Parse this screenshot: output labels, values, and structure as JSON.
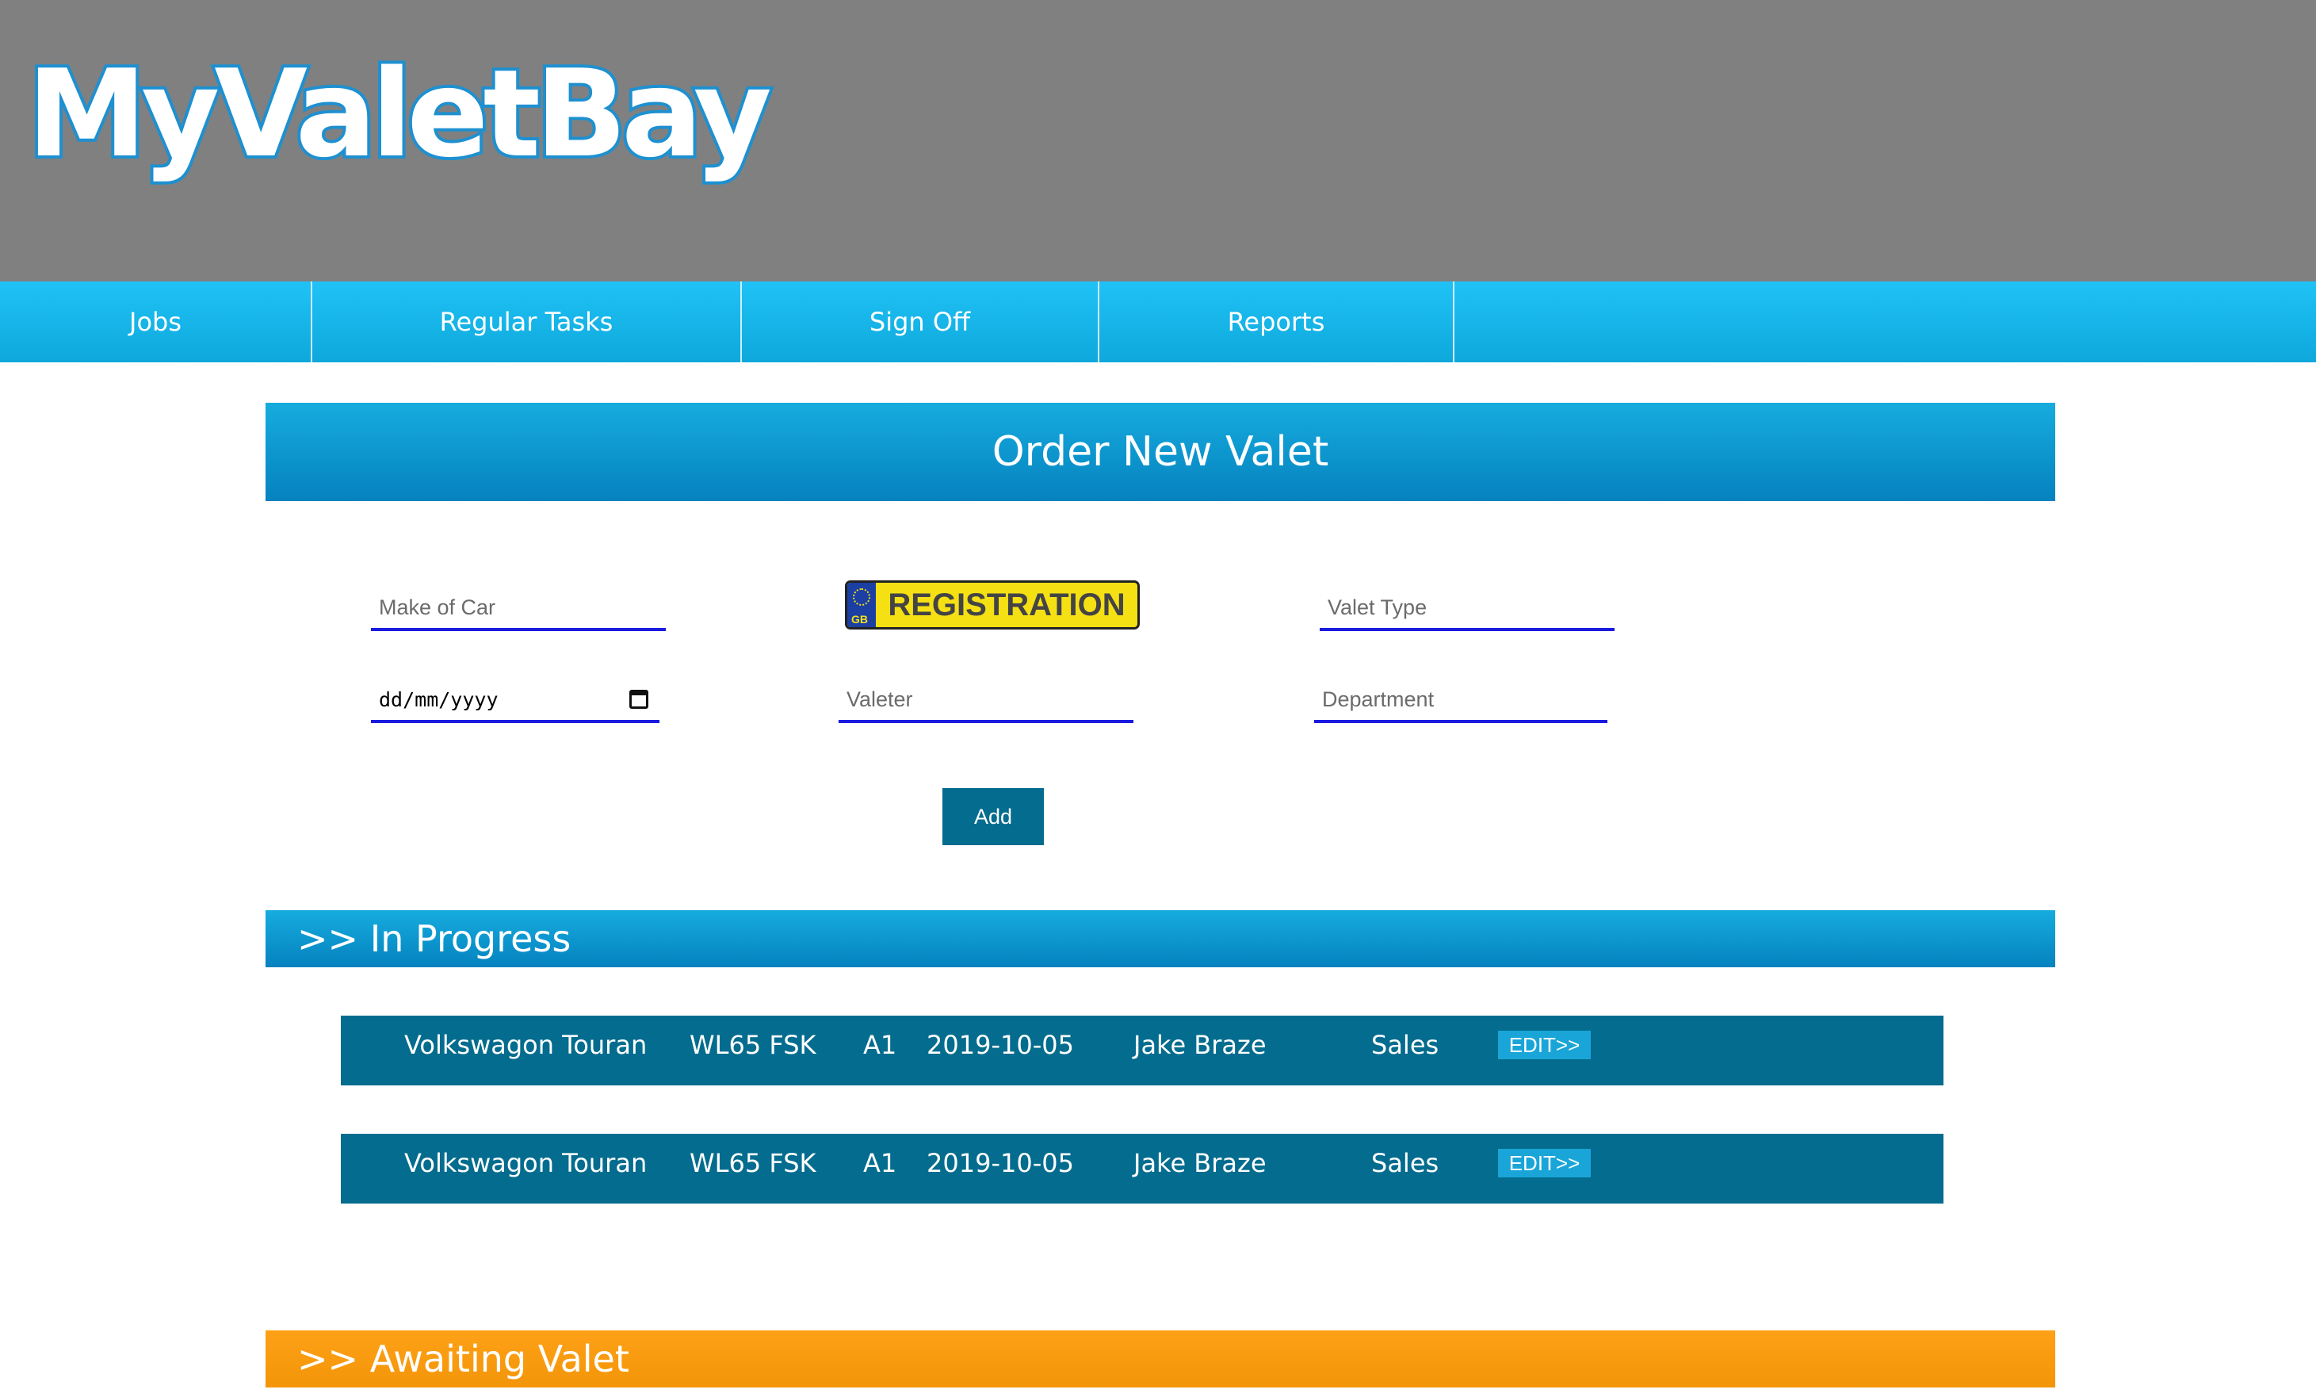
{
  "header": {
    "logo": "MyValetBay"
  },
  "nav": {
    "items": [
      {
        "label": "Jobs"
      },
      {
        "label": "Regular Tasks"
      },
      {
        "label": "Sign Off"
      },
      {
        "label": "Reports"
      }
    ]
  },
  "order_form": {
    "title": "Order New Valet",
    "make_placeholder": "Make of Car",
    "registration_plate_text": "REGISTRATION",
    "registration_plate_country": "GB",
    "valet_type_placeholder": "Valet Type",
    "date_placeholder": "dd/mm/yyyy",
    "valeter_placeholder": "Valeter",
    "department_placeholder": "Department",
    "add_label": "Add"
  },
  "in_progress": {
    "title": ">> In Progress",
    "rows": [
      {
        "make": "Volkswagon Touran",
        "reg": "WL65 FSK",
        "type": "A1",
        "date": "2019-10-05",
        "valeter": "Jake Braze",
        "department": "Sales",
        "edit": "EDIT>>"
      },
      {
        "make": "Volkswagon Touran",
        "reg": "WL65 FSK",
        "type": "A1",
        "date": "2019-10-05",
        "valeter": "Jake Braze",
        "department": "Sales",
        "edit": "EDIT>>"
      }
    ]
  },
  "awaiting": {
    "title": ">> Awaiting Valet"
  },
  "colors": {
    "header_bg": "#808080",
    "nav_blue": "#20c2f6",
    "section_blue": "#0582bf",
    "row_teal": "#046c8e",
    "awaiting_orange": "#f39508",
    "input_underline": "#1a1ae0"
  },
  "icons": [
    "calendar-icon",
    "gb-plate-icon"
  ]
}
